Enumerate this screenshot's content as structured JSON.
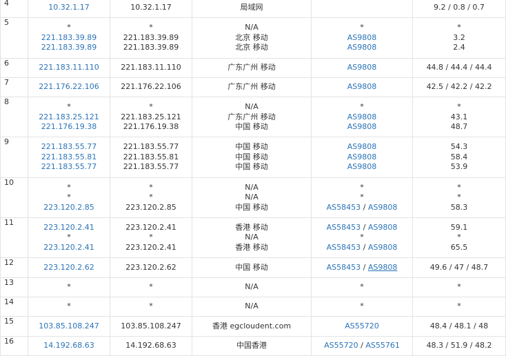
{
  "hops": [
    {
      "hop": "4",
      "ip": [
        "10.32.1.17"
      ],
      "host": [
        "10.32.1.17"
      ],
      "geo": [
        "局域网"
      ],
      "as": [
        []
      ],
      "rtt": [
        "9.2 / 0.8 / 0.7"
      ]
    },
    {
      "hop": "5",
      "ip": [
        "*",
        "221.183.39.89",
        "221.183.39.89"
      ],
      "host": [
        "*",
        "221.183.39.89",
        "221.183.39.89"
      ],
      "geo": [
        "N/A",
        "北京 移动",
        "北京 移动"
      ],
      "as": [
        [
          "*"
        ],
        [
          "AS9808"
        ],
        [
          "AS9808"
        ]
      ],
      "rtt": [
        "*",
        "3.2",
        "2.4"
      ]
    },
    {
      "hop": "6",
      "ip": [
        "221.183.11.110"
      ],
      "host": [
        "221.183.11.110"
      ],
      "geo": [
        "广东广州 移动"
      ],
      "as": [
        [
          "AS9808"
        ]
      ],
      "rtt": [
        "44.8 / 44.4 / 44.4"
      ]
    },
    {
      "hop": "7",
      "ip": [
        "221.176.22.106"
      ],
      "host": [
        "221.176.22.106"
      ],
      "geo": [
        "广东广州 移动"
      ],
      "as": [
        [
          "AS9808"
        ]
      ],
      "rtt": [
        "42.5 / 42.2 / 42.2"
      ]
    },
    {
      "hop": "8",
      "ip": [
        "*",
        "221.183.25.121",
        "221.176.19.38"
      ],
      "host": [
        "*",
        "221.183.25.121",
        "221.176.19.38"
      ],
      "geo": [
        "N/A",
        "广东广州 移动",
        "中国 移动"
      ],
      "as": [
        [
          "*"
        ],
        [
          "AS9808"
        ],
        [
          "AS9808"
        ]
      ],
      "rtt": [
        "*",
        "43.1",
        "48.7"
      ]
    },
    {
      "hop": "9",
      "ip": [
        "221.183.55.77",
        "221.183.55.81",
        "221.183.55.77"
      ],
      "host": [
        "221.183.55.77",
        "221.183.55.81",
        "221.183.55.77"
      ],
      "geo": [
        "中国 移动",
        "中国 移动",
        "中国 移动"
      ],
      "as": [
        [
          "AS9808"
        ],
        [
          "AS9808"
        ],
        [
          "AS9808"
        ]
      ],
      "rtt": [
        "54.3",
        "58.4",
        "53.9"
      ]
    },
    {
      "hop": "10",
      "ip": [
        "*",
        "*",
        "223.120.2.85"
      ],
      "host": [
        "*",
        "*",
        "223.120.2.85"
      ],
      "geo": [
        "N/A",
        "N/A",
        "中国 移动"
      ],
      "as": [
        [
          "*"
        ],
        [
          "*"
        ],
        [
          "AS58453",
          "AS9808"
        ]
      ],
      "rtt": [
        "*",
        "*",
        "58.3"
      ]
    },
    {
      "hop": "11",
      "ip": [
        "223.120.2.41",
        "*",
        "223.120.2.41"
      ],
      "host": [
        "223.120.2.41",
        "*",
        "223.120.2.41"
      ],
      "geo": [
        "香港 移动",
        "N/A",
        "香港 移动"
      ],
      "as": [
        [
          "AS58453",
          "AS9808"
        ],
        [
          "*"
        ],
        [
          "AS58453",
          "AS9808"
        ]
      ],
      "rtt": [
        "59.1",
        "*",
        "65.5"
      ]
    },
    {
      "hop": "12",
      "ip": [
        "223.120.2.62"
      ],
      "host": [
        "223.120.2.62"
      ],
      "geo": [
        "中国 移动"
      ],
      "as": [
        [
          "AS58453",
          "AS9808"
        ]
      ],
      "rtt": [
        "49.6 / 47 / 48.7"
      ]
    },
    {
      "hop": "13",
      "ip": [
        "*"
      ],
      "host": [
        "*"
      ],
      "geo": [
        "N/A"
      ],
      "as": [
        [
          "*"
        ]
      ],
      "rtt": [
        "*"
      ]
    },
    {
      "hop": "14",
      "ip": [
        "*"
      ],
      "host": [
        "*"
      ],
      "geo": [
        "N/A"
      ],
      "as": [
        [
          "*"
        ]
      ],
      "rtt": [
        "*"
      ]
    },
    {
      "hop": "15",
      "ip": [
        "103.85.108.247"
      ],
      "host": [
        "103.85.108.247"
      ],
      "geo": [
        "香港 egcloudent.com"
      ],
      "as": [
        [
          "AS55720"
        ]
      ],
      "rtt": [
        "48.4 / 48.1 / 48"
      ]
    },
    {
      "hop": "16",
      "ip": [
        "14.192.68.63"
      ],
      "host": [
        "14.192.68.63"
      ],
      "geo": [
        "中国香港"
      ],
      "as": [
        [
          "AS55720",
          "AS55761"
        ]
      ],
      "rtt": [
        "48.3 / 51.9 / 48.2"
      ]
    }
  ],
  "colors": {
    "link": "#2a73b8",
    "text": "#333333",
    "border": "#e3e3e3"
  }
}
